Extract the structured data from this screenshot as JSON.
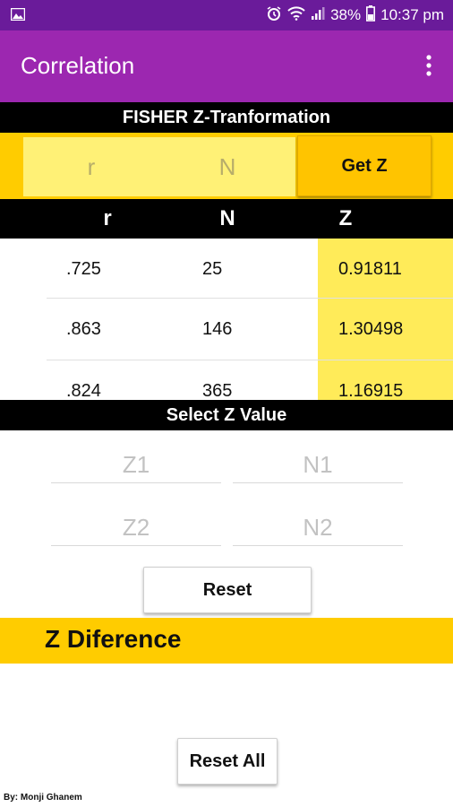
{
  "status_bar": {
    "battery": "38%",
    "time": "10:37 pm",
    "icons": [
      "image-icon",
      "alarm-icon",
      "wifi-icon",
      "signal-icon",
      "battery-icon"
    ]
  },
  "app_bar": {
    "title": "Correlation",
    "menu_icon": "more-vert-icon"
  },
  "fisher": {
    "header": "FISHER Z-Tranformation",
    "r_placeholder": "r",
    "n_placeholder": "N",
    "get_z_label": "Get Z"
  },
  "table": {
    "columns": [
      "r",
      "N",
      "Z"
    ],
    "rows": [
      {
        "r": ".725",
        "n": "25",
        "z": "0.91811"
      },
      {
        "r": ".863",
        "n": "146",
        "z": "1.30498"
      },
      {
        "r": ".824",
        "n": "365",
        "z": "1.16915"
      }
    ]
  },
  "select_z": {
    "header": "Select Z Value",
    "z1_placeholder": "Z1",
    "n1_placeholder": "N1",
    "z2_placeholder": "Z2",
    "n2_placeholder": "N2",
    "reset_label": "Reset"
  },
  "z_difference": {
    "label": "Z Diference"
  },
  "reset_all_label": "Reset All",
  "footer": "By: Monji Ghanem",
  "colors": {
    "status_bar": "#6a1b9a",
    "app_bar": "#9c27b0",
    "yellow": "#ffcc00",
    "light_yellow": "#fff176"
  }
}
